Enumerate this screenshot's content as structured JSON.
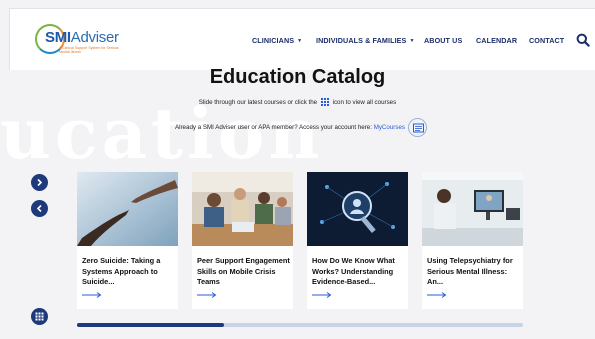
{
  "brand": {
    "logo_smi": "SMI",
    "logo_adviser": "Adviser",
    "tagline": "A Clinical Support System for Serious Mental Illness"
  },
  "nav": [
    {
      "label": "CLINICIANS",
      "has_caret": true
    },
    {
      "label": "INDIVIDUALS & FAMILIES",
      "has_caret": true
    },
    {
      "label": "ABOUT US",
      "has_caret": false
    },
    {
      "label": "CALENDAR",
      "has_caret": false
    },
    {
      "label": "CONTACT",
      "has_caret": false
    }
  ],
  "hero": {
    "background_word": "ucation",
    "title": "Education Catalog",
    "subtitle_before": "Slide through our latest courses or click the",
    "subtitle_after": "icon to view all courses",
    "member_text": "Already a SMI Adviser user or APA member? Access your account here:",
    "member_link": "MyCourses"
  },
  "cards": [
    {
      "title": "Zero Suicide: Taking a Systems Approach to Suicide..."
    },
    {
      "title": "Peer Support Engagement Skills on Mobile Crisis Teams"
    },
    {
      "title": "How Do We Know What Works? Understanding Evidence-Based..."
    },
    {
      "title": "Using Telepsychiatry for Serious Mental Illness: An..."
    }
  ],
  "carousel": {
    "progress": 0.33
  },
  "colors": {
    "navy": "#1e3a7b",
    "link": "#2a5bd7",
    "track": "#c6d4e6"
  },
  "icons": [
    "search-icon",
    "grid-icon",
    "chevron-right-icon",
    "chevron-left-icon",
    "arrow-right-icon",
    "course-list-icon"
  ]
}
